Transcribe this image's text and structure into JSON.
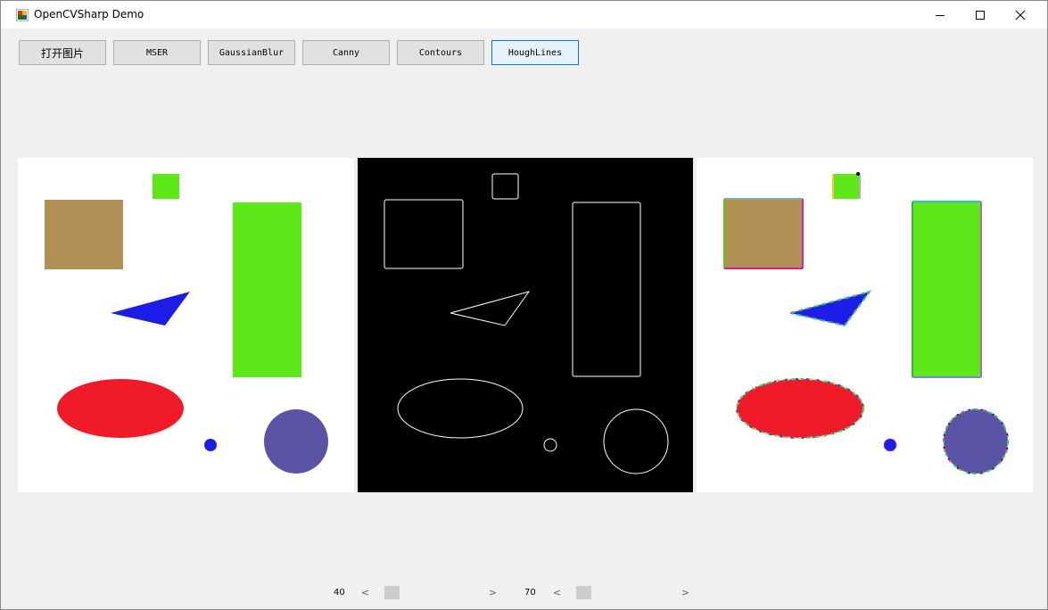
{
  "window": {
    "title": "OpenCVSharp Demo"
  },
  "toolbar": {
    "buttons": [
      {
        "label": "打开图片"
      },
      {
        "label": "MSER"
      },
      {
        "label": "GaussianBlur"
      },
      {
        "label": "Canny"
      },
      {
        "label": "Contours"
      },
      {
        "label": "HoughLines"
      }
    ],
    "active": "HoughLines"
  },
  "panels": {
    "original": {
      "background": "#ffffff"
    },
    "edges": {
      "background": "#000000",
      "stroke": "#ffffff"
    },
    "result": {
      "background": "#ffffff"
    }
  },
  "shapes": {
    "brown_square": "#b09055",
    "small_green_square": "#5ee81a",
    "green_rect": "#5ee81a",
    "blue_triangle": "#1c1ee8",
    "red_ellipse": "#f01a28",
    "small_blue_circle": "#1c1ee8",
    "purple_circle": "#5b54a6"
  },
  "scrollbars": {
    "threshold1": {
      "value": "40",
      "fraction": 0.12
    },
    "threshold2": {
      "value": "70",
      "fraction": 0.12
    }
  }
}
